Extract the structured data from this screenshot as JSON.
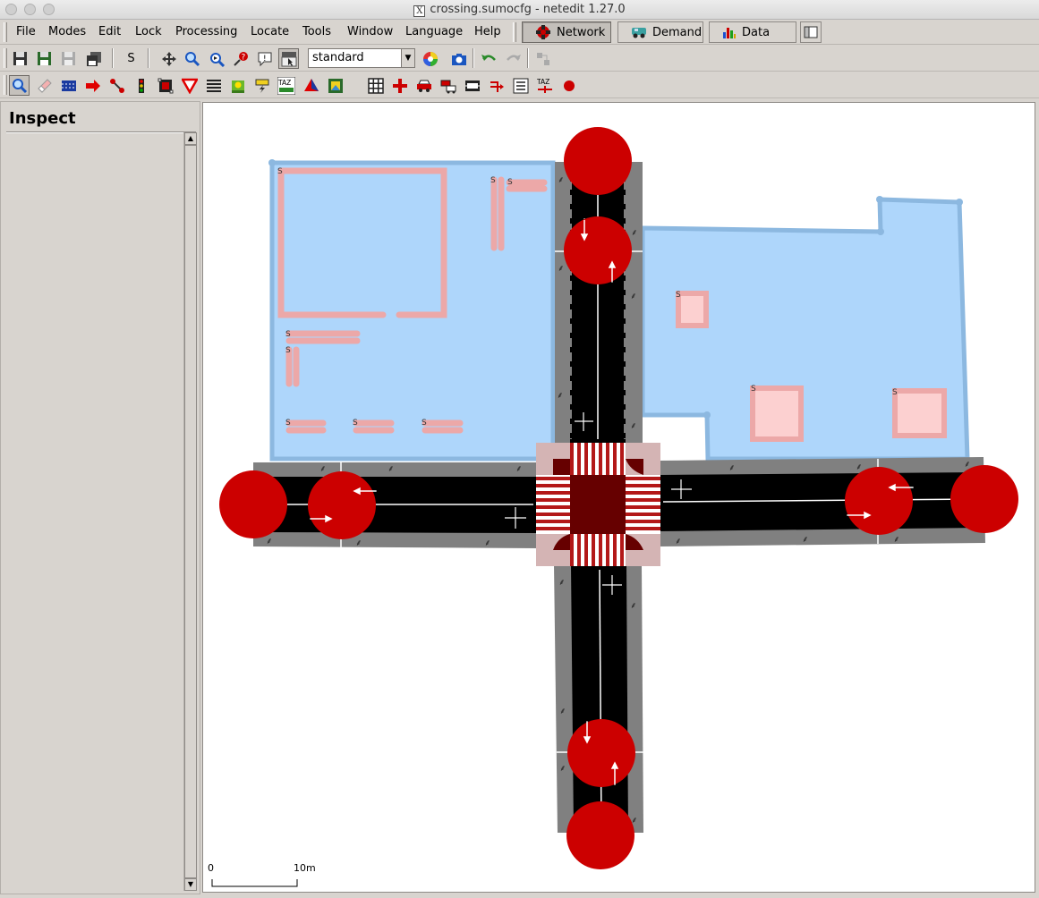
{
  "window": {
    "title": "crossing.sumocfg - netedit 1.27.0"
  },
  "menu": {
    "items": [
      "File",
      "Modes",
      "Edit",
      "Lock",
      "Processing",
      "Locate",
      "Tools",
      "Window",
      "Language",
      "Help"
    ],
    "supermodes": {
      "network": "Network",
      "demand": "Demand",
      "data": "Data"
    }
  },
  "toolbar": {
    "s_label": "S",
    "scheme_select": "standard",
    "taz_label": "TAZ"
  },
  "panel": {
    "title": "Inspect"
  },
  "canvas": {
    "scale_start": "0",
    "scale_end": "10m",
    "poi_label": "S"
  },
  "colors": {
    "junction": "#cc0000",
    "polygon": "#aad4fa",
    "poi": "#f0a8a8",
    "road": "#000000",
    "sidewalk": "#808080",
    "crossing_junction": "#660000"
  }
}
